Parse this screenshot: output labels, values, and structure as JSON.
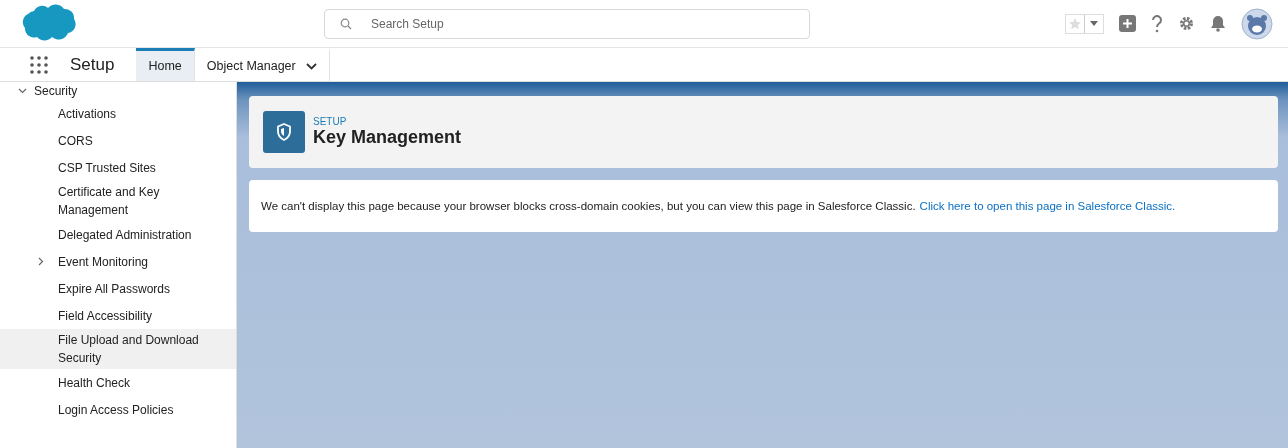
{
  "header": {
    "search": {
      "placeholder": "Search Setup"
    }
  },
  "nav": {
    "app_name": "Setup",
    "tabs": [
      {
        "label": "Home",
        "selected": true,
        "menu": false
      },
      {
        "label": "Object Manager",
        "selected": false,
        "menu": true
      }
    ]
  },
  "sidebar": {
    "tree": [
      {
        "label": "Security",
        "expanded": true,
        "children": [
          {
            "label": "Activations",
            "selected": false
          },
          {
            "label": "CORS",
            "selected": false
          },
          {
            "label": "CSP Trusted Sites",
            "selected": false
          },
          {
            "label": "Certificate and Key Management",
            "selected": false
          },
          {
            "label": "Delegated Administration",
            "selected": false
          },
          {
            "label": "Event Monitoring",
            "selected": false,
            "expanded": false
          },
          {
            "label": "Expire All Passwords",
            "selected": false
          },
          {
            "label": "Field Accessibility",
            "selected": false
          },
          {
            "label": "File Upload and Download Security",
            "selected": true
          },
          {
            "label": "Health Check",
            "selected": false
          },
          {
            "label": "Login Access Policies",
            "selected": false
          }
        ]
      }
    ]
  },
  "page_header": {
    "eyebrow": "SETUP",
    "title": "Key Management"
  },
  "message": {
    "text": "We can't display this page because your browser blocks cross-domain cookies, but you can view this page in Salesforce Classic.",
    "link": "Click here to open this page in Salesforce Classic."
  }
}
